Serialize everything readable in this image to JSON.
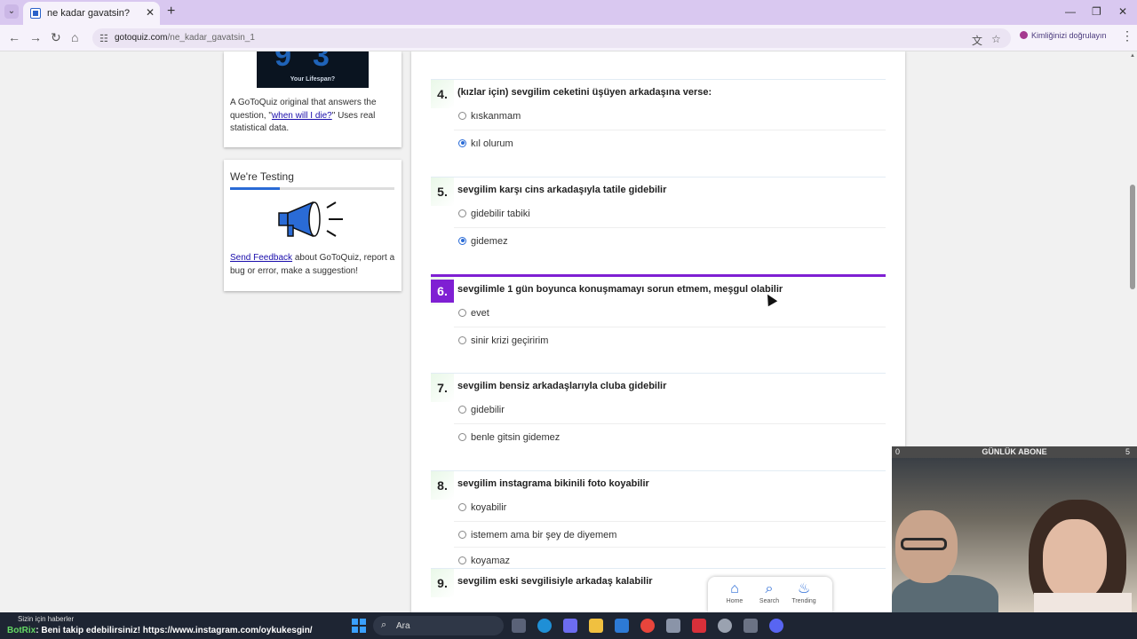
{
  "browser": {
    "tab_title": "ne kadar gavatsin?",
    "url_host": "gotoquiz.com",
    "url_path": "/ne_kadar_gavatsin_1",
    "verify_label": "Kimliğinizi doğrulayın"
  },
  "sidebar": {
    "lifespan_caption": "Your Lifespan?",
    "lifespan_big": "93",
    "desc_before": "A GoToQuiz original that answers the question, \"",
    "desc_link": "when will I die?",
    "desc_after": "\" Uses real statistical data.",
    "testing_title": "We're Testing",
    "testing_progress": 0.3,
    "feedback_link": "Send Feedback",
    "feedback_text": " about GoToQuiz, report a bug or error, make a suggestion!"
  },
  "questions": [
    {
      "num": "4.",
      "text": "(kızlar için) sevgilim ceketini üşüyen arkadaşına verse:",
      "options": [
        "kıskanmam",
        "kıl olurum"
      ],
      "selected": 1
    },
    {
      "num": "5.",
      "text": "sevgilim karşı cins arkadaşıyla tatile gidebilir",
      "options": [
        "gidebilir tabiki",
        "gidemez"
      ],
      "selected": 1
    },
    {
      "num": "6.",
      "text": "sevgilimle 1 gün boyunca konuşmamayı sorun etmem, meşgul olabilir",
      "options": [
        "evet",
        "sinir krizi geçiririm"
      ],
      "selected": -1
    },
    {
      "num": "7.",
      "text": "sevgilim bensiz arkadaşlarıyla cluba gidebilir",
      "options": [
        "gidebilir",
        "benle gitsin gidemez"
      ],
      "selected": -1
    },
    {
      "num": "8.",
      "text": "sevgilim instagrama bikinili foto koyabilir",
      "options": [
        "koyabilir",
        "istemem ama bir şey de diyemem",
        "koyamaz"
      ],
      "selected": -1
    },
    {
      "num": "9.",
      "text": "sevgilim eski sevgilisiyle arkadaş kalabilir",
      "options": [],
      "selected": -1
    }
  ],
  "mininav": {
    "home": "Home",
    "search": "Search",
    "trending": "Trending"
  },
  "stream": {
    "overlay_left": "0",
    "overlay_title": "GÜNLÜK ABONE",
    "overlay_right": "5",
    "news_label": "Sizin için haberler",
    "ticker_name": "BotRix",
    "ticker_text": "Beni takip edebilirsiniz! https://www.instagram.com/oykukesgin/"
  },
  "taskbar": {
    "search_placeholder": "Ara"
  },
  "colors": {
    "accent": "#7f1fd3",
    "link": "#1a0dab",
    "radio": "#2a6bd6"
  }
}
